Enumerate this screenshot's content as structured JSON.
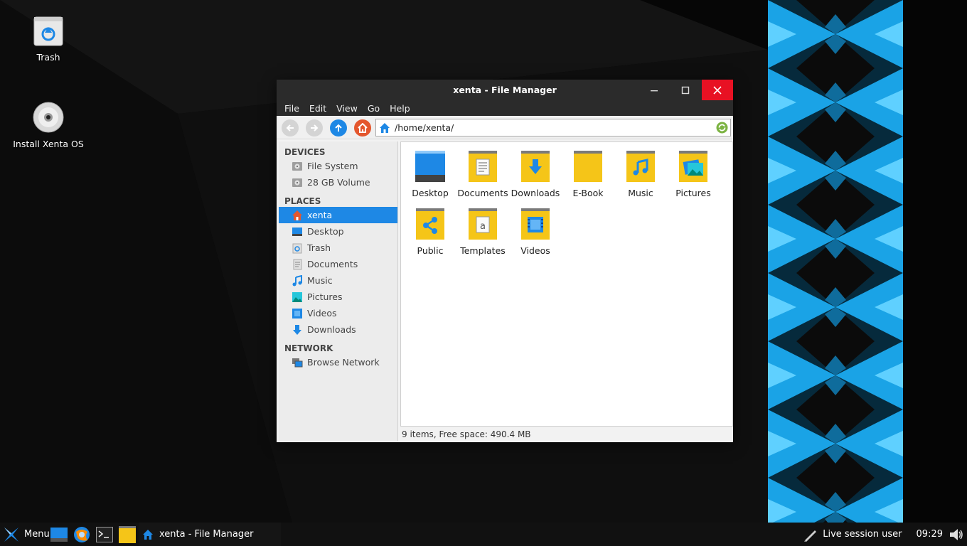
{
  "desktop": {
    "icons": [
      {
        "label": "Trash",
        "icon": "trash-icon"
      },
      {
        "label": "Install Xenta OS",
        "icon": "cd-disc-icon"
      }
    ]
  },
  "window": {
    "title": "xenta - File Manager",
    "menus": [
      "File",
      "Edit",
      "View",
      "Go",
      "Help"
    ],
    "address": "/home/xenta/",
    "sidebar": {
      "devices_title": "DEVICES",
      "devices": [
        {
          "label": "File System",
          "icon": "drive-icon"
        },
        {
          "label": "28 GB Volume",
          "icon": "drive-icon"
        }
      ],
      "places_title": "PLACES",
      "places": [
        {
          "label": "xenta",
          "icon": "home-icon",
          "active": true
        },
        {
          "label": "Desktop",
          "icon": "desktop-icon"
        },
        {
          "label": "Trash",
          "icon": "trash-icon"
        },
        {
          "label": "Documents",
          "icon": "documents-icon"
        },
        {
          "label": "Music",
          "icon": "music-icon"
        },
        {
          "label": "Pictures",
          "icon": "pictures-icon"
        },
        {
          "label": "Videos",
          "icon": "videos-icon"
        },
        {
          "label": "Downloads",
          "icon": "downloads-icon"
        }
      ],
      "network_title": "NETWORK",
      "network": [
        {
          "label": "Browse Network",
          "icon": "network-icon"
        }
      ]
    },
    "files": [
      {
        "label": "Desktop",
        "icon": "desktop-folder-icon"
      },
      {
        "label": "Documents",
        "icon": "documents-folder-icon"
      },
      {
        "label": "Downloads",
        "icon": "downloads-folder-icon"
      },
      {
        "label": "E-Book",
        "icon": "folder-icon"
      },
      {
        "label": "Music",
        "icon": "music-folder-icon"
      },
      {
        "label": "Pictures",
        "icon": "pictures-folder-icon"
      },
      {
        "label": "Public",
        "icon": "public-folder-icon"
      },
      {
        "label": "Templates",
        "icon": "templates-folder-icon"
      },
      {
        "label": "Videos",
        "icon": "videos-folder-icon"
      }
    ],
    "status": "9 items, Free space: 490.4 MB"
  },
  "taskbar": {
    "menu_label": "Menu",
    "window_label": "xenta - File Manager",
    "user": "Live session user",
    "clock": "09:29"
  },
  "colors": {
    "accent": "#1e88e5",
    "folder": "#f5c518",
    "close": "#e81123"
  }
}
